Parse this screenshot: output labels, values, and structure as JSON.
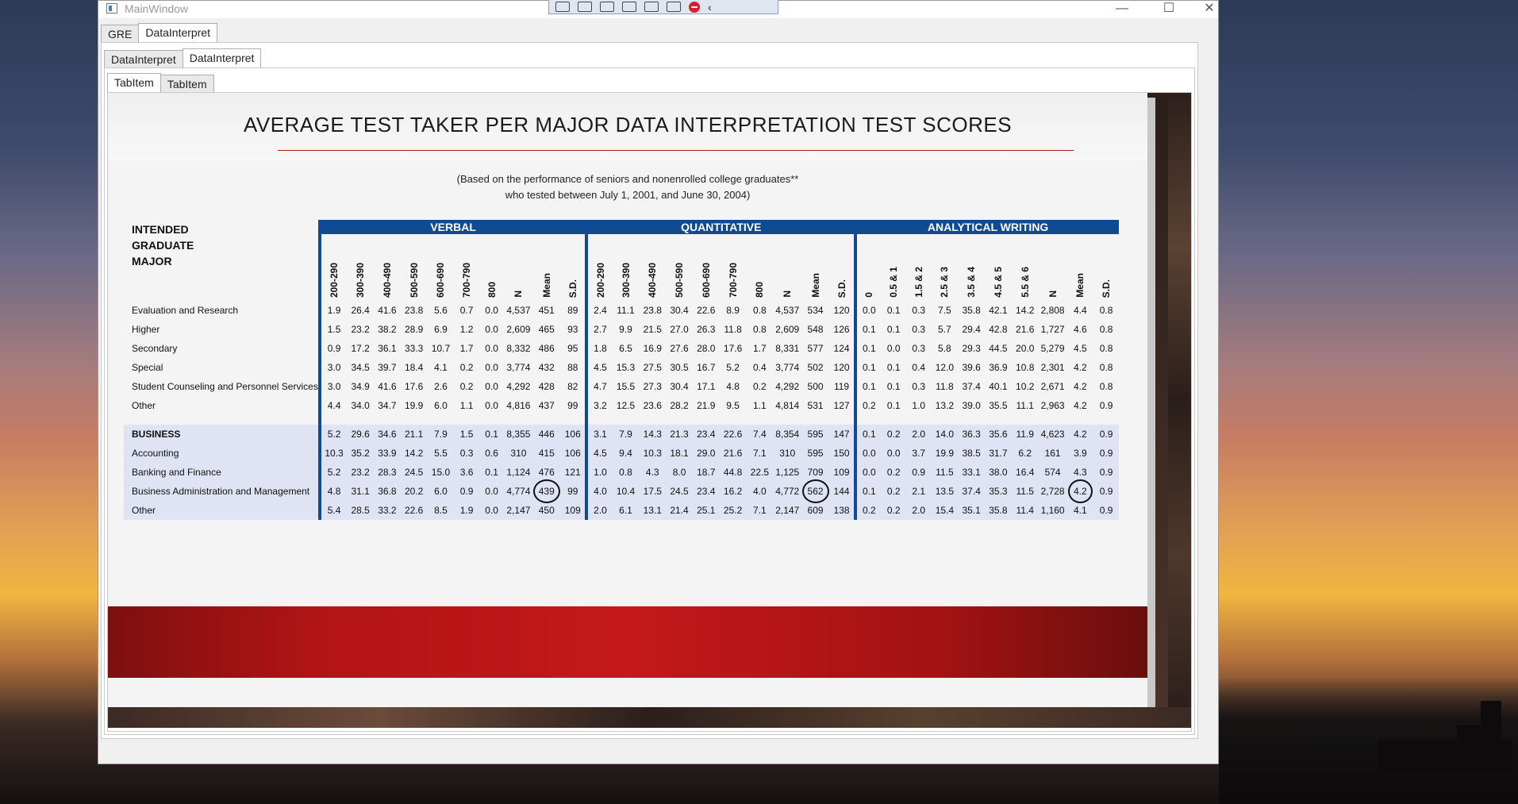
{
  "window": {
    "title": "MainWindow"
  },
  "window_controls": {
    "minimize": "—",
    "maximize": "☐",
    "close": "✕"
  },
  "outer_tabs": [
    "GRE",
    "DataInterpret"
  ],
  "middle_tabs": [
    "DataInterpret",
    "DataInterpret"
  ],
  "inner_tabs": [
    "TabItem",
    "TabItem"
  ],
  "image": {
    "title": "AVERAGE TEST TAKER PER MAJOR DATA INTERPRETATION TEST SCORES",
    "subtitle_line1": "(Based on the performance of seniors and nonenrolled college graduates**",
    "subtitle_line2": "who tested between July 1, 2001, and June 30, 2004)",
    "major_header_1": "INTENDED",
    "major_header_2": "GRADUATE",
    "major_header_3": "MAJOR",
    "group_verbal": "VERBAL",
    "group_quant": "QUANTITATIVE",
    "group_aw": "ANALYTICAL WRITING",
    "verbal_cols": [
      "200-290",
      "300-390",
      "400-490",
      "500-590",
      "600-690",
      "700-790",
      "800",
      "N",
      "Mean",
      "S.D."
    ],
    "quant_cols": [
      "200-290",
      "300-390",
      "400-490",
      "500-590",
      "600-690",
      "700-790",
      "800",
      "N",
      "Mean",
      "S.D."
    ],
    "aw_cols": [
      "0",
      "0.5 & 1",
      "1.5 & 2",
      "2.5 & 3",
      "3.5 & 4",
      "4.5 & 5",
      "5.5 & 6",
      "N",
      "Mean",
      "S.D."
    ]
  },
  "rows": [
    {
      "label": "Evaluation and Research",
      "cells": [
        "1.9",
        "26.4",
        "41.6",
        "23.8",
        "5.6",
        "0.7",
        "0.0",
        "4,537",
        "451",
        "89",
        "2.4",
        "11.1",
        "23.8",
        "30.4",
        "22.6",
        "8.9",
        "0.8",
        "4,537",
        "534",
        "120",
        "0.0",
        "0.1",
        "0.3",
        "7.5",
        "35.8",
        "42.1",
        "14.2",
        "2,808",
        "4.4",
        "0.8"
      ]
    },
    {
      "label": "Higher",
      "cells": [
        "1.5",
        "23.2",
        "38.2",
        "28.9",
        "6.9",
        "1.2",
        "0.0",
        "2,609",
        "465",
        "93",
        "2.7",
        "9.9",
        "21.5",
        "27.0",
        "26.3",
        "11.8",
        "0.8",
        "2,609",
        "548",
        "126",
        "0.1",
        "0.1",
        "0.3",
        "5.7",
        "29.4",
        "42.8",
        "21.6",
        "1,727",
        "4.6",
        "0.8"
      ]
    },
    {
      "label": "Secondary",
      "cells": [
        "0.9",
        "17.2",
        "36.1",
        "33.3",
        "10.7",
        "1.7",
        "0.0",
        "8,332",
        "486",
        "95",
        "1.8",
        "6.5",
        "16.9",
        "27.6",
        "28.0",
        "17.6",
        "1.7",
        "8,331",
        "577",
        "124",
        "0.1",
        "0.0",
        "0.3",
        "5.8",
        "29.3",
        "44.5",
        "20.0",
        "5,279",
        "4.5",
        "0.8"
      ]
    },
    {
      "label": "Special",
      "cells": [
        "3.0",
        "34.5",
        "39.7",
        "18.4",
        "4.1",
        "0.2",
        "0.0",
        "3,774",
        "432",
        "88",
        "4.5",
        "15.3",
        "27.5",
        "30.5",
        "16.7",
        "5.2",
        "0.4",
        "3,774",
        "502",
        "120",
        "0.1",
        "0.1",
        "0.4",
        "12.0",
        "39.6",
        "36.9",
        "10.8",
        "2,301",
        "4.2",
        "0.8"
      ]
    },
    {
      "label": "Student Counseling and Personnel Services",
      "cells": [
        "3.0",
        "34.9",
        "41.6",
        "17.6",
        "2.6",
        "0.2",
        "0.0",
        "4,292",
        "428",
        "82",
        "4.7",
        "15.5",
        "27.3",
        "30.4",
        "17.1",
        "4.8",
        "0.2",
        "4,292",
        "500",
        "119",
        "0.1",
        "0.1",
        "0.3",
        "11.8",
        "37.4",
        "40.1",
        "10.2",
        "2,671",
        "4.2",
        "0.8"
      ]
    },
    {
      "label": "Other",
      "cells": [
        "4.4",
        "34.0",
        "34.7",
        "19.9",
        "6.0",
        "1.1",
        "0.0",
        "4,816",
        "437",
        "99",
        "3.2",
        "12.5",
        "23.6",
        "28.2",
        "21.9",
        "9.5",
        "1.1",
        "4,814",
        "531",
        "127",
        "0.2",
        "0.1",
        "1.0",
        "13.2",
        "39.0",
        "35.5",
        "11.1",
        "2,963",
        "4.2",
        "0.9"
      ]
    },
    {
      "label": "BUSINESS",
      "cells": [
        "5.2",
        "29.6",
        "34.6",
        "21.1",
        "7.9",
        "1.5",
        "0.1",
        "8,355",
        "446",
        "106",
        "3.1",
        "7.9",
        "14.3",
        "21.3",
        "23.4",
        "22.6",
        "7.4",
        "8,354",
        "595",
        "147",
        "0.1",
        "0.2",
        "2.0",
        "14.0",
        "36.3",
        "35.6",
        "11.9",
        "4,623",
        "4.2",
        "0.9"
      ]
    },
    {
      "label": "Accounting",
      "cells": [
        "10.3",
        "35.2",
        "33.9",
        "14.2",
        "5.5",
        "0.3",
        "0.6",
        "310",
        "415",
        "106",
        "4.5",
        "9.4",
        "10.3",
        "18.1",
        "29.0",
        "21.6",
        "7.1",
        "310",
        "595",
        "150",
        "0.0",
        "0.0",
        "3.7",
        "19.9",
        "38.5",
        "31.7",
        "6.2",
        "161",
        "3.9",
        "0.9"
      ]
    },
    {
      "label": "Banking and Finance",
      "cells": [
        "5.2",
        "23.2",
        "28.3",
        "24.5",
        "15.0",
        "3.6",
        "0.1",
        "1,124",
        "476",
        "121",
        "1.0",
        "0.8",
        "4.3",
        "8.0",
        "18.7",
        "44.8",
        "22.5",
        "1,125",
        "709",
        "109",
        "0.0",
        "0.2",
        "0.9",
        "11.5",
        "33.1",
        "38.0",
        "16.4",
        "574",
        "4.3",
        "0.9"
      ]
    },
    {
      "label": "Business Administration and Management",
      "cells": [
        "4.8",
        "31.1",
        "36.8",
        "20.2",
        "6.0",
        "0.9",
        "0.0",
        "4,774",
        "439",
        "99",
        "4.0",
        "10.4",
        "17.5",
        "24.5",
        "23.4",
        "16.2",
        "4.0",
        "4,772",
        "562",
        "144",
        "0.1",
        "0.2",
        "2.1",
        "13.5",
        "37.4",
        "35.3",
        "11.5",
        "2,728",
        "4.2",
        "0.9"
      ]
    },
    {
      "label": "Other",
      "cells": [
        "5.4",
        "28.5",
        "33.2",
        "22.6",
        "8.5",
        "1.9",
        "0.0",
        "2,147",
        "450",
        "109",
        "2.0",
        "6.1",
        "13.1",
        "21.4",
        "25.1",
        "25.2",
        "7.1",
        "2,147",
        "609",
        "138",
        "0.2",
        "0.2",
        "2.0",
        "15.4",
        "35.1",
        "35.8",
        "11.4",
        "1,160",
        "4.1",
        "0.9"
      ]
    }
  ]
}
